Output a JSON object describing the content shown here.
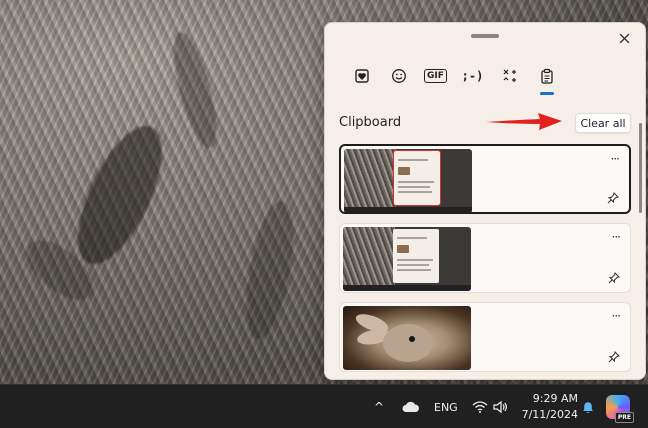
{
  "panel": {
    "tabs": [
      {
        "name": "favorites-stickers",
        "icon": "heart-sticker-icon"
      },
      {
        "name": "emoji",
        "icon": "smiley-icon"
      },
      {
        "name": "gif",
        "label": "GIF"
      },
      {
        "name": "kaomoji",
        "label": ";-)"
      },
      {
        "name": "symbols",
        "icon": "symbols-icon"
      },
      {
        "name": "clipboard",
        "icon": "clipboard-icon",
        "active": true
      }
    ],
    "section_title": "Clipboard",
    "clear_all_label": "Clear all",
    "more_glyph": "···",
    "items": [
      {
        "kind": "screenshot",
        "selected": true
      },
      {
        "kind": "screenshot",
        "selected": false
      },
      {
        "kind": "photo",
        "selected": false
      }
    ]
  },
  "taskbar": {
    "chevron": "^",
    "language": "ENG",
    "time": "9:29 AM",
    "date": "7/11/2024",
    "copilot_badge": "PRE"
  },
  "colors": {
    "accent": "#1a6fc9",
    "arrow": "#e3201b",
    "panel_bg": "#f5efe8",
    "taskbar_bg": "#202020"
  }
}
